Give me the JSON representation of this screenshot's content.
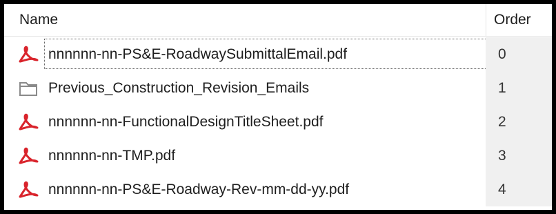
{
  "columns": {
    "name": "Name",
    "order": "Order"
  },
  "rows": [
    {
      "label": "nnnnnn-nn-PS&E-RoadwaySubmittalEmail.pdf",
      "order": "0",
      "icon": "pdf-icon"
    },
    {
      "label": "Previous_Construction_Revision_Emails",
      "order": "1",
      "icon": "folder-icon"
    },
    {
      "label": "nnnnnn-nn-FunctionalDesignTitleSheet.pdf",
      "order": "2",
      "icon": "pdf-icon"
    },
    {
      "label": "nnnnnn-nn-TMP.pdf",
      "order": "3",
      "icon": "pdf-icon"
    },
    {
      "label": "nnnnnn-nn-PS&E-Roadway-Rev-mm-dd-yy.pdf",
      "order": "4",
      "icon": "pdf-icon"
    }
  ],
  "colors": {
    "pdf_red": "#d9242c",
    "folder_gray": "#8a8a8a",
    "order_bg": "#f0f0f0"
  }
}
